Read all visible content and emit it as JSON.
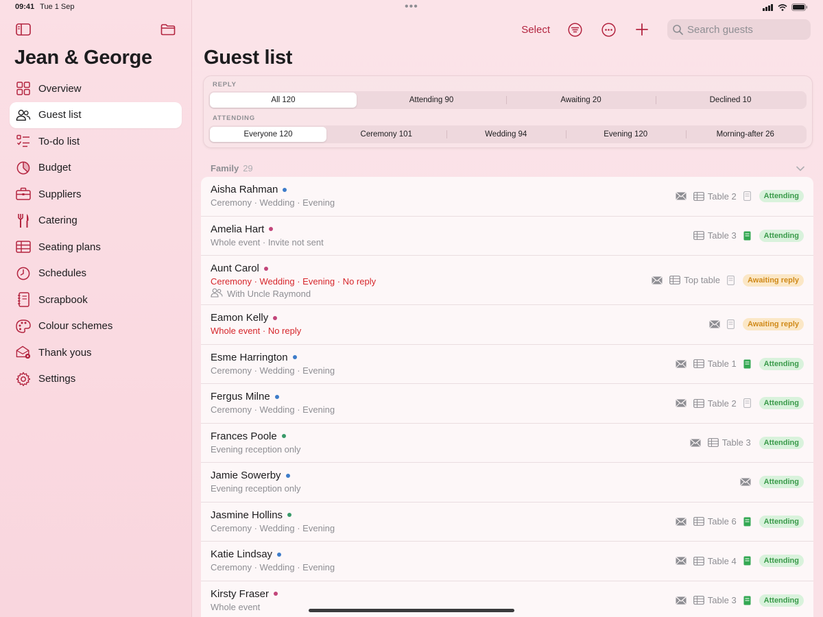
{
  "status": {
    "time": "09:41",
    "date": "Tue 1 Sep"
  },
  "sidebar": {
    "title": "Jean & George",
    "items": [
      {
        "label": "Overview",
        "icon": "grid-icon",
        "active": false
      },
      {
        "label": "Guest list",
        "icon": "people-icon",
        "active": true
      },
      {
        "label": "To-do list",
        "icon": "checklist-icon",
        "active": false
      },
      {
        "label": "Budget",
        "icon": "pie-chart-icon",
        "active": false
      },
      {
        "label": "Suppliers",
        "icon": "briefcase-icon",
        "active": false
      },
      {
        "label": "Catering",
        "icon": "fork-knife-icon",
        "active": false
      },
      {
        "label": "Seating plans",
        "icon": "table-grid-icon",
        "active": false
      },
      {
        "label": "Schedules",
        "icon": "clock-icon",
        "active": false
      },
      {
        "label": "Scrapbook",
        "icon": "notebook-icon",
        "active": false
      },
      {
        "label": "Colour schemes",
        "icon": "palette-icon",
        "active": false
      },
      {
        "label": "Thank yous",
        "icon": "envelope-badge-icon",
        "active": false
      },
      {
        "label": "Settings",
        "icon": "gear-icon",
        "active": false
      }
    ]
  },
  "toolbar": {
    "select_label": "Select",
    "search_placeholder": "Search guests"
  },
  "main": {
    "title": "Guest list"
  },
  "filters": {
    "reply_label": "REPLY",
    "reply": [
      "All 120",
      "Attending 90",
      "Awaiting 20",
      "Declined 10"
    ],
    "attending_label": "ATTENDING",
    "attending": [
      "Everyone 120",
      "Ceremony 101",
      "Wedding 94",
      "Evening 120",
      "Morning-after 26"
    ]
  },
  "section": {
    "title": "Family",
    "count": "29"
  },
  "colors": {
    "accent": "#b3243f",
    "dot_blue": "#3d7cc9",
    "dot_pink": "#c2457a",
    "dot_green": "#3a9a6a"
  },
  "guests": [
    {
      "name": "Aisha Rahman",
      "dot": "blue",
      "sub": "Ceremony · Wedding · Evening",
      "warn": false,
      "extra": "",
      "mail": true,
      "table": "Table 2",
      "meal": "gray",
      "status": "Attending"
    },
    {
      "name": "Amelia Hart",
      "dot": "pink",
      "sub": "Whole event · Invite not sent",
      "warn": false,
      "extra": "",
      "mail": false,
      "table": "Table 3",
      "meal": "green",
      "status": "Attending"
    },
    {
      "name": "Aunt Carol",
      "dot": "pink",
      "sub": "Ceremony · Wedding · Evening · No reply",
      "warn": true,
      "extra": "With Uncle Raymond",
      "mail": true,
      "table": "Top table",
      "meal": "gray",
      "status": "Awaiting reply"
    },
    {
      "name": "Eamon Kelly",
      "dot": "pink",
      "sub": "Whole event · No reply",
      "warn": true,
      "extra": "",
      "mail": true,
      "table": "",
      "meal": "gray",
      "status": "Awaiting reply"
    },
    {
      "name": "Esme Harrington",
      "dot": "blue",
      "sub": "Ceremony · Wedding · Evening",
      "warn": false,
      "extra": "",
      "mail": true,
      "table": "Table 1",
      "meal": "green",
      "status": "Attending"
    },
    {
      "name": "Fergus Milne",
      "dot": "blue",
      "sub": "Ceremony · Wedding · Evening",
      "warn": false,
      "extra": "",
      "mail": true,
      "table": "Table 2",
      "meal": "gray",
      "status": "Attending"
    },
    {
      "name": "Frances Poole",
      "dot": "green",
      "sub": "Evening reception only",
      "warn": false,
      "extra": "",
      "mail": true,
      "table": "Table 3",
      "meal": "",
      "status": "Attending"
    },
    {
      "name": "Jamie Sowerby",
      "dot": "blue",
      "sub": "Evening reception only",
      "warn": false,
      "extra": "",
      "mail": true,
      "table": "",
      "meal": "",
      "status": "Attending"
    },
    {
      "name": "Jasmine Hollins",
      "dot": "green",
      "sub": "Ceremony · Wedding · Evening",
      "warn": false,
      "extra": "",
      "mail": true,
      "table": "Table 6",
      "meal": "green",
      "status": "Attending"
    },
    {
      "name": "Katie Lindsay",
      "dot": "blue",
      "sub": "Ceremony · Wedding · Evening",
      "warn": false,
      "extra": "",
      "mail": true,
      "table": "Table 4",
      "meal": "green",
      "status": "Attending"
    },
    {
      "name": "Kirsty Fraser",
      "dot": "pink",
      "sub": "Whole event",
      "warn": false,
      "extra": "",
      "mail": true,
      "table": "Table 3",
      "meal": "green",
      "status": "Attending"
    }
  ]
}
